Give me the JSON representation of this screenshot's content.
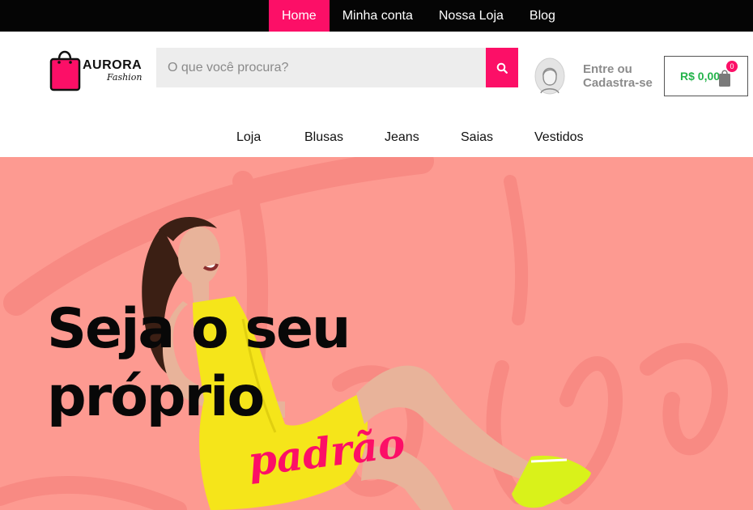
{
  "topnav": {
    "items": [
      {
        "label": "Home",
        "active": true
      },
      {
        "label": "Minha conta"
      },
      {
        "label": "Nossa Loja"
      },
      {
        "label": "Blog"
      }
    ]
  },
  "logo": {
    "brand": "AURORA",
    "tagline": "Fashion",
    "icon": "shopping-bag-icon"
  },
  "search": {
    "placeholder": "O que você procura?",
    "icon": "search-icon"
  },
  "account": {
    "label": "Entre ou Cadastra-se",
    "icon": "user-avatar-icon"
  },
  "cart": {
    "amount": "R$ 0,00",
    "count": "0",
    "icon": "bag-icon"
  },
  "mainnav": {
    "items": [
      "Loja",
      "Blusas",
      "Jeans",
      "Saias",
      "Vestidos"
    ]
  },
  "hero": {
    "headline_line1": "Seja o seu",
    "headline_line2": "próprio",
    "script_word": "padrão",
    "background_watermark": "Fashion"
  },
  "colors": {
    "accent": "#fc0f67",
    "topbar": "#050505",
    "hero_bg": "#fd9a91",
    "price": "#24b34b",
    "dress": "#f5e51a"
  }
}
